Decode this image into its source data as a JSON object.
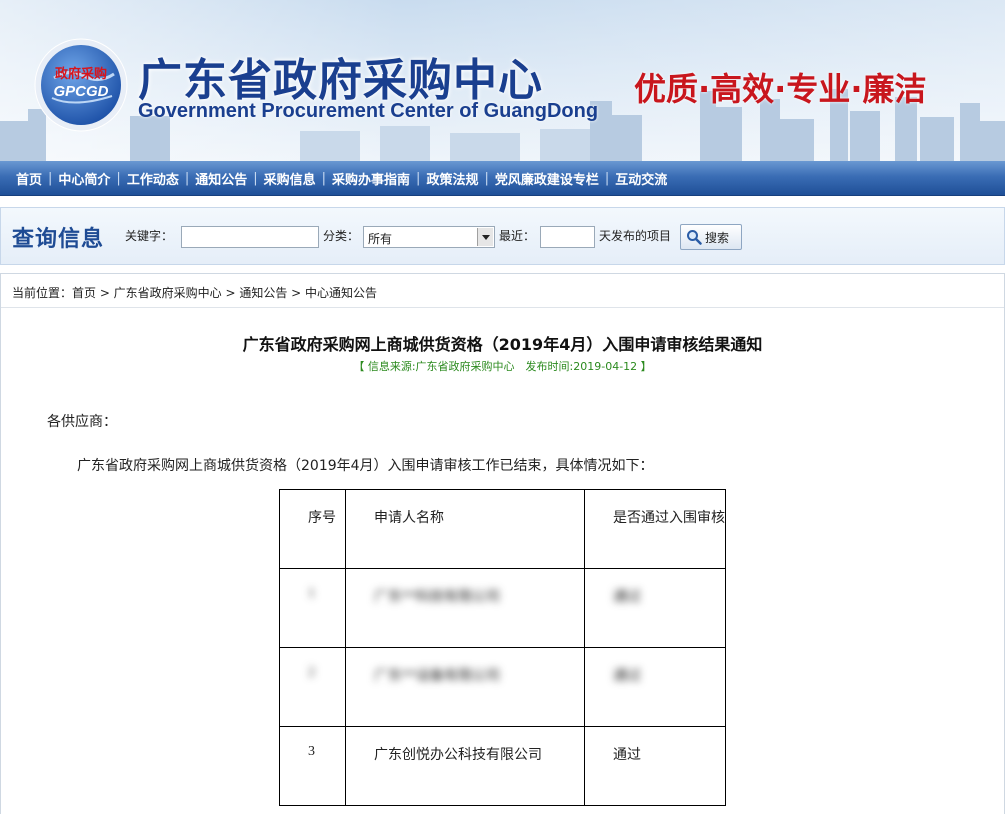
{
  "header": {
    "logo_text_top": "政府采购",
    "logo_text_bottom": "GPCGD",
    "title_cn": "广东省政府采购中心",
    "title_en": "Government Procurement Center of GuangDong",
    "slogan": "优质·高效·专业·廉洁"
  },
  "nav": {
    "items": [
      "首页",
      "中心简介",
      "工作动态",
      "通知公告",
      "采购信息",
      "采购办事指南",
      "政策法规",
      "党风廉政建设专栏",
      "互动交流"
    ]
  },
  "search": {
    "title": "查询信息",
    "keyword_label": "关键字：",
    "keyword_value": "",
    "category_label": "分类：",
    "category_value": "所有",
    "recent_label": "最近：",
    "recent_value": "",
    "days_label": "天发布的项目",
    "button_label": "搜索"
  },
  "breadcrumb": "当前位置：首页 > 广东省政府采购中心 > 通知公告 > 中心通知公告",
  "article": {
    "title": "广东省政府采购网上商城供货资格（2019年4月）入围申请审核结果通知",
    "meta": "【 信息来源:广东省政府采购中心　发布时间:2019-04-12 】",
    "greeting": "各供应商：",
    "intro": "广东省政府采购网上商城供货资格（2019年4月）入围申请审核工作已结束，具体情况如下：",
    "table": {
      "headers": [
        "序号",
        "申请人名称",
        "是否通过入围审核"
      ],
      "rows": [
        [
          "1",
          "广东**科技有限公司",
          "通过"
        ],
        [
          "2",
          "广东**设备有限公司",
          "通过"
        ],
        [
          "3",
          "广东创悦办公科技有限公司",
          "通过"
        ]
      ]
    }
  },
  "colors": {
    "nav_blue": "#2a5ca6",
    "title_blue": "#1a3f8f",
    "slogan_red": "#c8161d",
    "meta_green": "#2b8a1e"
  }
}
